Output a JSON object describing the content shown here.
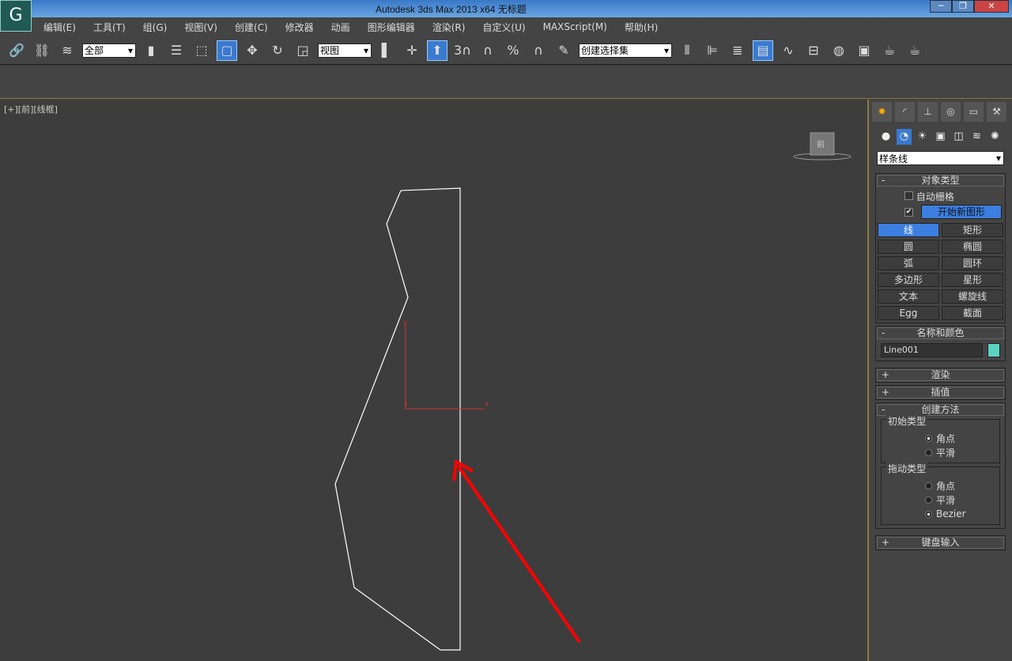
{
  "window": {
    "title": "Autodesk 3ds Max  2013 x64    无标题",
    "minimize": "─",
    "maximize": "❐",
    "close": "✕",
    "logo": "G"
  },
  "menu": [
    "编辑(E)",
    "工具(T)",
    "组(G)",
    "视图(V)",
    "创建(C)",
    "修改器",
    "动画",
    "图形编辑器",
    "渲染(R)",
    "自定义(U)",
    "MAXScript(M)",
    "帮助(H)"
  ],
  "toolbar": {
    "filter": "全部",
    "refcoord": "视图",
    "selset": "创建选择集",
    "snap3": "3",
    "anglesnap": "⊿",
    "percent": "%"
  },
  "viewport": {
    "label": "[+][前][线框]",
    "axis_x": "x",
    "axis_y": "y",
    "axis_z": "z",
    "viewcube": "前"
  },
  "panel": {
    "category": "样条线",
    "object_type": {
      "title": "对象类型",
      "autogrid": "自动栅格",
      "autogrid_checked": false,
      "start_new_shape": "开始新图形",
      "start_new_checked": true,
      "buttons": [
        "线",
        "矩形",
        "圆",
        "椭圆",
        "弧",
        "圆环",
        "多边形",
        "星形",
        "文本",
        "螺旋线",
        "Egg",
        "截面"
      ],
      "active": "线"
    },
    "name_color": {
      "title": "名称和颜色",
      "name": "Line001",
      "color": "#5ad2c0"
    },
    "render": "渲染",
    "interp": "插值",
    "creation": {
      "title": "创建方法",
      "initial": "初始类型",
      "initial_opts": [
        "角点",
        "平滑"
      ],
      "initial_sel": "角点",
      "drag": "拖动类型",
      "drag_opts": [
        "角点",
        "平滑",
        "Bezier"
      ],
      "drag_sel": "Bezier"
    },
    "keyboard": "键盘输入"
  }
}
